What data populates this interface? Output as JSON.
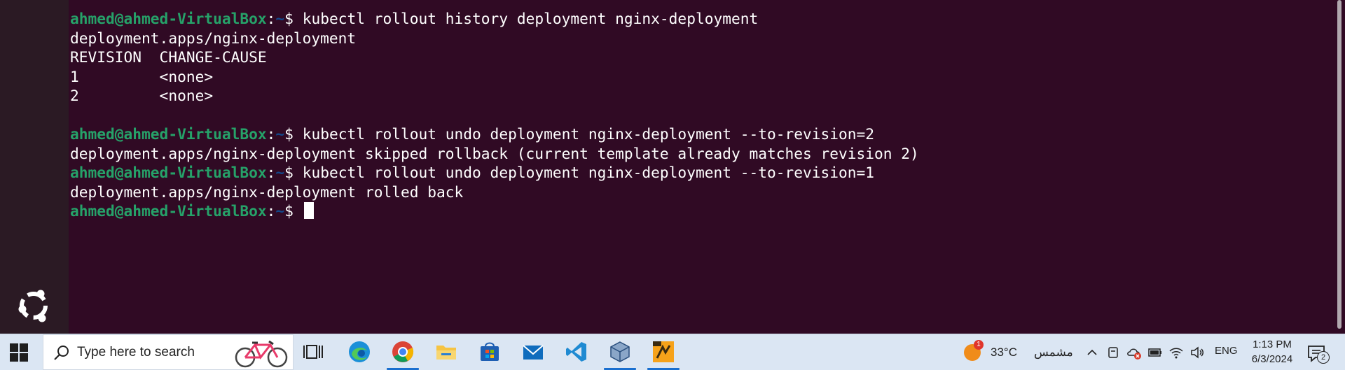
{
  "terminal": {
    "lines": [
      {
        "user": "ahmed@ahmed-VirtualBox",
        "sep": ":",
        "path": "~",
        "prompt": "$ ",
        "cmd": "kubectl rollout history deployment nginx-deployment"
      },
      {
        "text": "deployment.apps/nginx-deployment"
      },
      {
        "text": "REVISION  CHANGE-CAUSE"
      },
      {
        "text": "1         <none>"
      },
      {
        "text": "2         <none>"
      },
      {
        "text": ""
      },
      {
        "user": "ahmed@ahmed-VirtualBox",
        "sep": ":",
        "path": "~",
        "prompt": "$ ",
        "cmd": "kubectl rollout undo deployment nginx-deployment --to-revision=2"
      },
      {
        "text": "deployment.apps/nginx-deployment skipped rollback (current template already matches revision 2)"
      },
      {
        "user": "ahmed@ahmed-VirtualBox",
        "sep": ":",
        "path": "~",
        "prompt": "$ ",
        "cmd": "kubectl rollout undo deployment nginx-deployment --to-revision=1"
      },
      {
        "text": "deployment.apps/nginx-deployment rolled back"
      },
      {
        "user": "ahmed@ahmed-VirtualBox",
        "sep": ":",
        "path": "~",
        "prompt": "$ ",
        "cmd": ""
      }
    ]
  },
  "dock": {
    "logo_icon": "ubuntu-logo-icon"
  },
  "taskbar": {
    "search_placeholder": "Type here to search",
    "apps": [
      "task-view-icon",
      "edge-icon",
      "chrome-icon",
      "file-explorer-icon",
      "microsoft-store-icon",
      "mail-icon",
      "vscode-icon",
      "virtualbox-icon",
      "xampp-icon"
    ],
    "weather": {
      "temp": "33°C",
      "desc": "مشمس",
      "badge": "1"
    },
    "tray": [
      "chevron-up-icon",
      "meet-now-icon",
      "onedrive-error-icon",
      "battery-icon",
      "wifi-icon",
      "volume-icon"
    ],
    "language": "ENG",
    "time": "1:13 PM",
    "date": "6/3/2024",
    "notification_count": "2"
  },
  "colors": {
    "terminal_bg": "#300a24",
    "user_green": "#26a269",
    "path_blue": "#12488b",
    "taskbar_bg": "#dbe6f3"
  }
}
